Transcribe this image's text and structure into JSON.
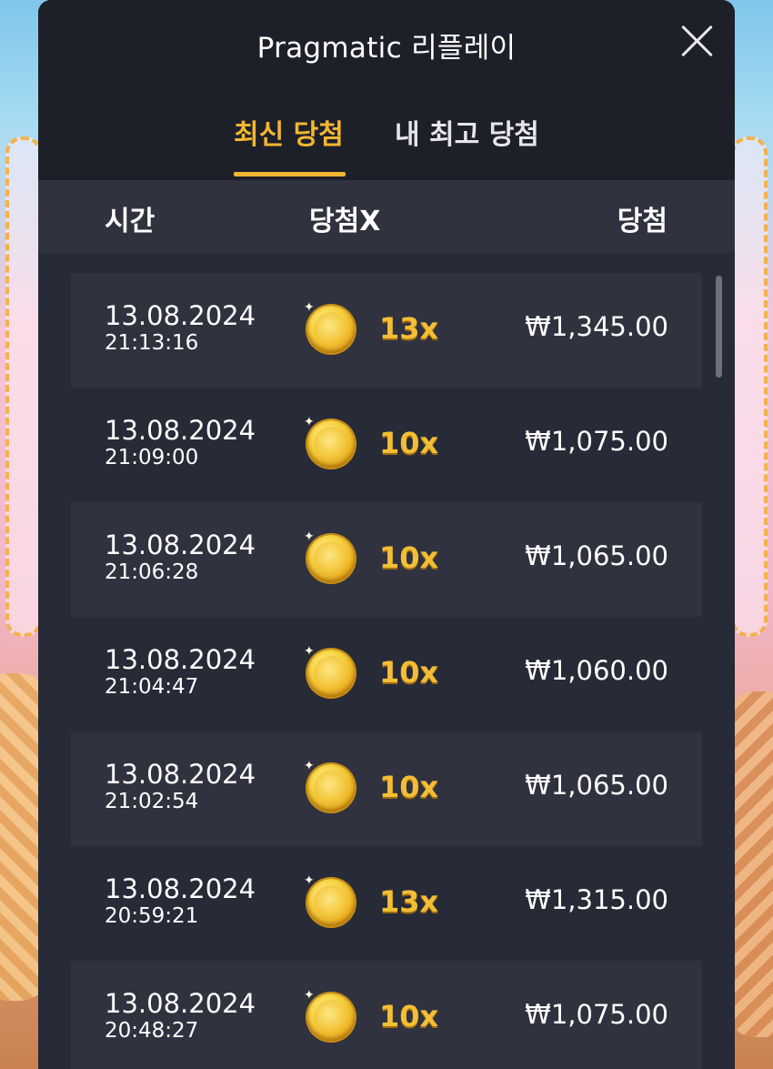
{
  "modal": {
    "title": "Pragmatic 리플레이",
    "close_icon": "close-icon"
  },
  "tabs": [
    {
      "label": "최신 당첨",
      "active": true
    },
    {
      "label": "내 최고 당첨",
      "active": false
    }
  ],
  "columns": {
    "time": "시간",
    "multiplier": "당첨X",
    "win": "당첨"
  },
  "rows": [
    {
      "date": "13.08.2024",
      "time": "21:13:16",
      "multiplier": "13x",
      "amount": "₩1,345.00"
    },
    {
      "date": "13.08.2024",
      "time": "21:09:00",
      "multiplier": "10x",
      "amount": "₩1,075.00"
    },
    {
      "date": "13.08.2024",
      "time": "21:06:28",
      "multiplier": "10x",
      "amount": "₩1,065.00"
    },
    {
      "date": "13.08.2024",
      "time": "21:04:47",
      "multiplier": "10x",
      "amount": "₩1,060.00"
    },
    {
      "date": "13.08.2024",
      "time": "21:02:54",
      "multiplier": "10x",
      "amount": "₩1,065.00"
    },
    {
      "date": "13.08.2024",
      "time": "20:59:21",
      "multiplier": "13x",
      "amount": "₩1,315.00"
    },
    {
      "date": "13.08.2024",
      "time": "20:48:27",
      "multiplier": "10x",
      "amount": "₩1,075.00"
    }
  ],
  "colors": {
    "accent": "#f2b632",
    "modal_bg": "#272a37",
    "header_bg": "#1e2029"
  }
}
